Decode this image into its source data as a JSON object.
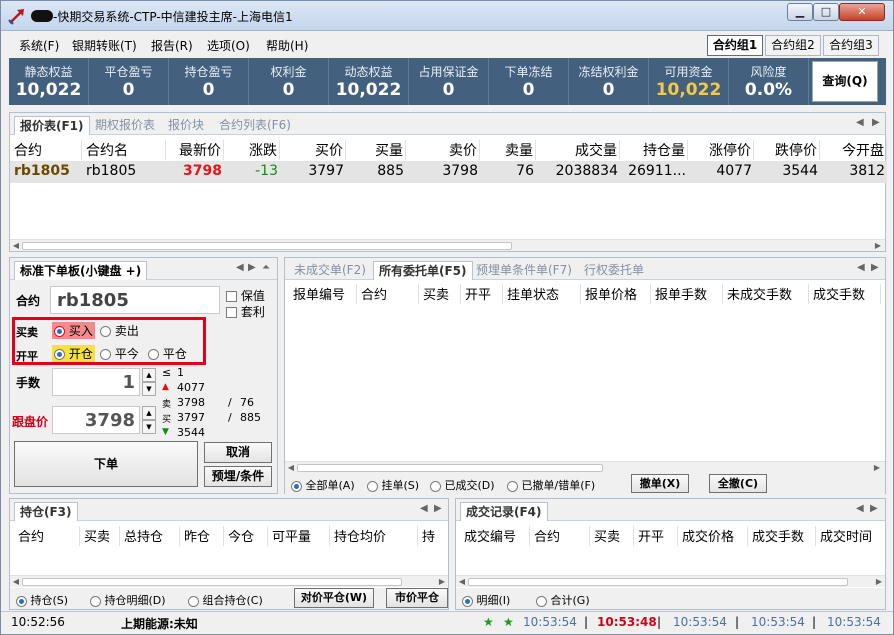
{
  "window": {
    "title": "-快期交易系统-CTP-中信建投主席-上海电信1",
    "min_glyph": "▁",
    "max_glyph": "□",
    "close_glyph": "✕"
  },
  "menu": {
    "items": [
      "系统(F)",
      "银期转账(T)",
      "报告(R)",
      "选项(O)",
      "帮助(H)"
    ],
    "groups": [
      "合约组1",
      "合约组2",
      "合约组3"
    ]
  },
  "account": {
    "cells": [
      {
        "label": "静态权益",
        "value": "10,022"
      },
      {
        "label": "平仓盈亏",
        "value": "0"
      },
      {
        "label": "持仓盈亏",
        "value": "0"
      },
      {
        "label": "权利金",
        "value": "0"
      },
      {
        "label": "动态权益",
        "value": "10,022"
      },
      {
        "label": "占用保证金",
        "value": "0"
      },
      {
        "label": "下单冻结",
        "value": "0"
      },
      {
        "label": "冻结权利金",
        "value": "0"
      },
      {
        "label": "可用资金",
        "value": "10,022"
      },
      {
        "label": "风险度",
        "value": "0.0%"
      }
    ],
    "query_label": "查询(Q)"
  },
  "quote": {
    "tabs": [
      "报价表(F1)",
      "期权报价表",
      "报价块",
      "合约列表(F6)"
    ],
    "headers": [
      "合约",
      "合约名",
      "最新价",
      "涨跌",
      "买价",
      "买量",
      "卖价",
      "卖量",
      "成交量",
      "持仓量",
      "涨停价",
      "跌停价",
      "今开盘"
    ],
    "row": {
      "code": "rb1805",
      "name": "rb1805",
      "last": "3798",
      "change": "-13",
      "bid": "3797",
      "bid_vol": "885",
      "ask": "3798",
      "ask_vol": "76",
      "volume": "2038834",
      "oi": "26911...",
      "upper": "4077",
      "lower": "3544",
      "open": "3812"
    }
  },
  "order_panel": {
    "tab": "标准下单板(小键盘 +)",
    "contract_label": "合约",
    "contract_value": "rb1805",
    "hedge_label": "保值",
    "arb_label": "套利",
    "side_label": "买卖",
    "buy_label": "买入",
    "sell_label": "卖出",
    "offset_label": "开平",
    "open_label": "开仓",
    "close_today_label": "平今",
    "close_label": "平仓",
    "qty_label": "手数",
    "qty_value": "1",
    "price_label": "跟盘价",
    "price_value": "3798",
    "info": {
      "le": "≤",
      "lim_qty": "1",
      "upper": "4077",
      "ask_tag": "卖",
      "ask": "3798",
      "ask_vol": "76",
      "bid_tag": "买",
      "bid": "3797",
      "bid_vol": "885",
      "lower": "3544",
      "slash": "/"
    },
    "order_btn": "下单",
    "cancel_btn": "取消",
    "condition_btn": "预埋/条件"
  },
  "orders": {
    "tabs": [
      "未成交单(F2)",
      "所有委托单(F5)",
      "预埋单条件单(F7)",
      "行权委托单"
    ],
    "headers": [
      "报单编号",
      "合约",
      "买卖",
      "开平",
      "挂单状态",
      "报单价格",
      "报单手数",
      "未成交手数",
      "成交手数"
    ],
    "filters": [
      "全部单(A)",
      "挂单(S)",
      "已成交(D)",
      "已撤单/错单(F)"
    ],
    "cancel_btn": "撤单(X)",
    "cancel_all_btn": "全撤(C)"
  },
  "positions": {
    "tab": "持仓(F3)",
    "headers": [
      "合约",
      "买卖",
      "总持仓",
      "昨仓",
      "今仓",
      "可平量",
      "持仓均价",
      "持"
    ],
    "filters": [
      "持仓(S)",
      "持仓明细(D)",
      "组合持仓(C)"
    ],
    "counter_close_btn": "对价平仓(W)",
    "market_close_btn": "市价平仓"
  },
  "trades": {
    "tab": "成交记录(F4)",
    "headers": [
      "成交编号",
      "合约",
      "买卖",
      "开平",
      "成交价格",
      "成交手数",
      "成交时间"
    ],
    "filters": [
      "明细(I)",
      "合计(G)"
    ]
  },
  "status": {
    "time": "10:52:56",
    "exchange": "上期能源:未知",
    "times": [
      "10:53:54",
      "10:53:48",
      "10:53:54",
      "10:53:54",
      "10:53:54"
    ],
    "sep": "|"
  },
  "colors": {
    "account_bg": "#43617f",
    "available_gold": "#f5c84a",
    "up_red": "#e0161b",
    "down_green": "#138a13",
    "highlight_box": "#e2001a",
    "buy_highlight": "#f28c8c",
    "open_highlight": "#f7e046"
  }
}
